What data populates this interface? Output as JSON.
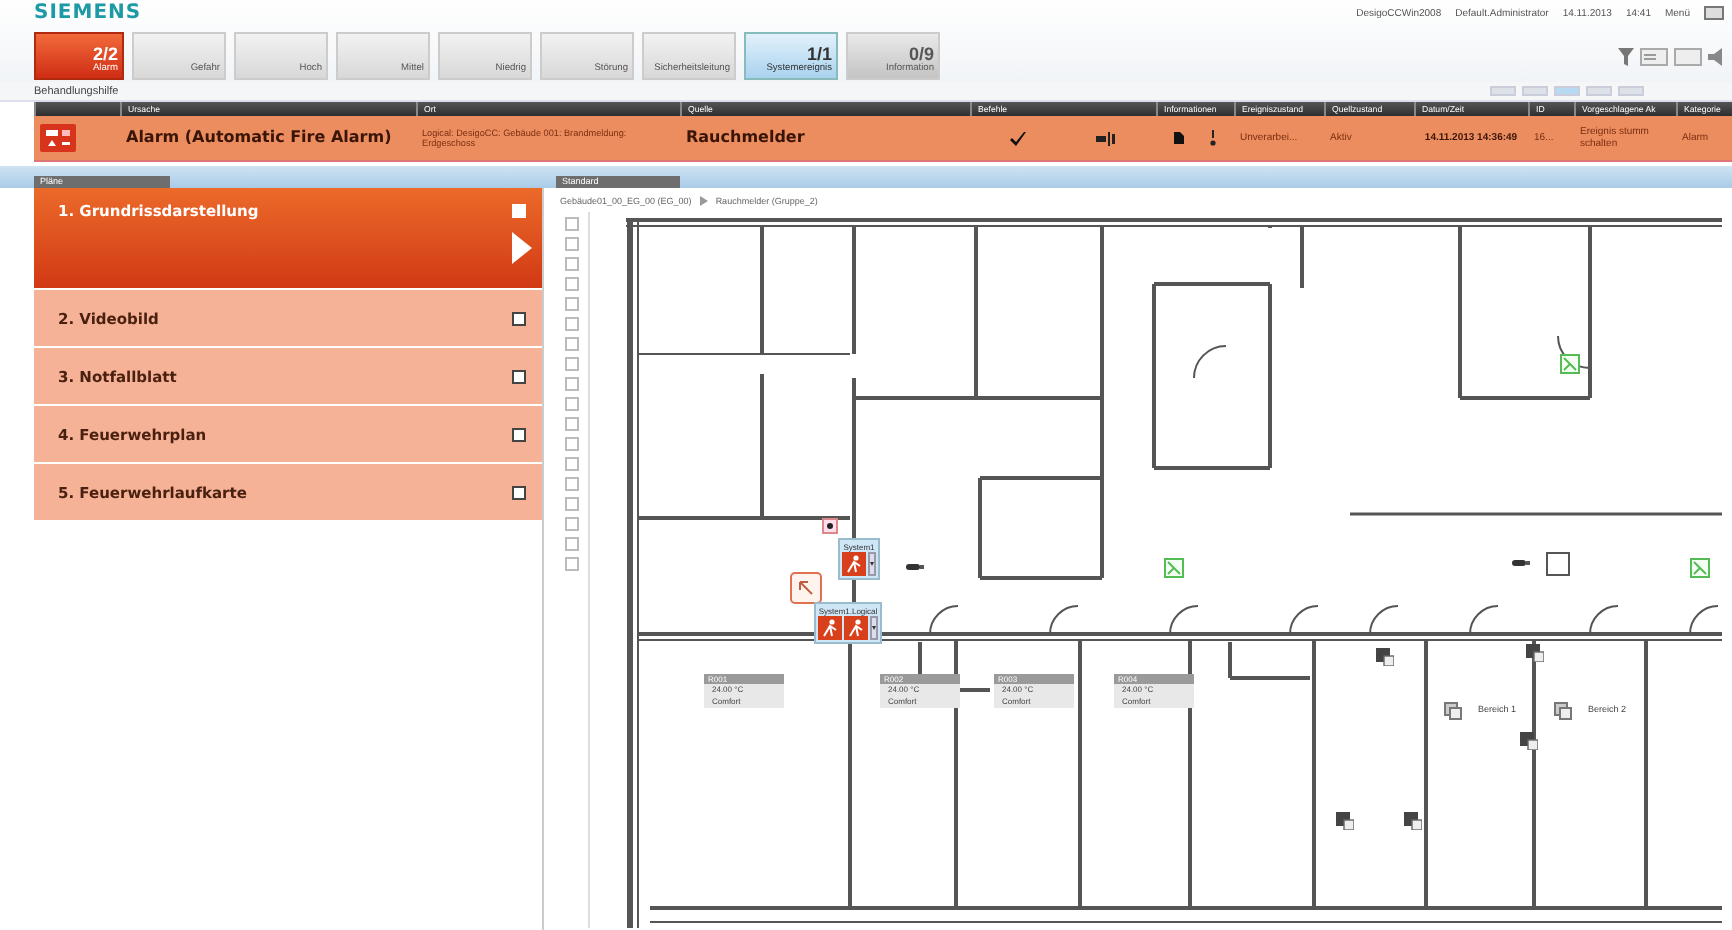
{
  "header": {
    "logo": "SIEMENS",
    "user_info": [
      "DesigoCCWin2008",
      "Default.Administrator",
      "14.11.2013",
      "14:41",
      "Menü"
    ]
  },
  "summary_buttons": [
    {
      "kind": "alarm",
      "count": "2/2",
      "label": "Alarm"
    },
    {
      "kind": "empty",
      "label": "Gefahr"
    },
    {
      "kind": "empty",
      "label": "Hoch"
    },
    {
      "kind": "empty",
      "label": "Mittel"
    },
    {
      "kind": "empty",
      "label": "Niedrig"
    },
    {
      "kind": "empty",
      "label": "Störung"
    },
    {
      "kind": "empty",
      "label": "Sicherheitsleitung"
    },
    {
      "kind": "system",
      "count": "1/1",
      "label": "Systemereignis"
    },
    {
      "kind": "info",
      "count": "0/9",
      "label": "Information"
    }
  ],
  "section_title": "Behandlungshilfe",
  "event_list": {
    "columns": [
      "Ursache",
      "Ort",
      "Quelle",
      "Befehle",
      "Informationen",
      "Ereigniszustand",
      "Quellzustand",
      "Datum/Zeit",
      "ID",
      "Vorgeschlagene Ak",
      "Kategorie"
    ],
    "rows": [
      {
        "cause": "Alarm (Automatic Fire Alarm)",
        "location": "Logical: DesigoCC: Gebäude 001: Brandmeldung: Erdgeschoss",
        "source": "Rauchmelder",
        "event_state": "Unverarbei...",
        "source_state": "Aktiv",
        "datetime": "14.11.2013 14:36:49",
        "id": "16...",
        "suggested_action": "Ereignis stumm schalten",
        "category": "Alarm"
      }
    ]
  },
  "steps_panel": {
    "title": "Pläne",
    "steps": [
      {
        "label": "1. Grundrissdarstellung",
        "selected": true,
        "checked": false
      },
      {
        "label": "2. Videobild",
        "selected": false,
        "checked": false
      },
      {
        "label": "3. Notfallblatt",
        "selected": false,
        "checked": false
      },
      {
        "label": "4. Feuerwehrplan",
        "selected": false,
        "checked": false
      },
      {
        "label": "5. Feuerwehrlaufkarte",
        "selected": false,
        "checked": false
      }
    ]
  },
  "plan_panel": {
    "title": "Standard",
    "breadcrumb": [
      "Gebäude01_00_EG_00 (EG_00)",
      "Rauchmelder (Gruppe_2)"
    ],
    "popups": [
      {
        "title": "System1"
      },
      {
        "title": "System1.Logical"
      }
    ],
    "room_tags": [
      {
        "name": "R001",
        "temperature": "24.00 °C",
        "mode": "Comfort"
      },
      {
        "name": "R002",
        "temperature": "24.00 °C",
        "mode": "Comfort"
      },
      {
        "name": "R003",
        "temperature": "24.00 °C",
        "mode": "Comfort"
      },
      {
        "name": "R004",
        "temperature": "24.00 °C",
        "mode": "Comfort"
      }
    ],
    "areas": [
      "Bereich 1",
      "Bereich 2"
    ]
  }
}
